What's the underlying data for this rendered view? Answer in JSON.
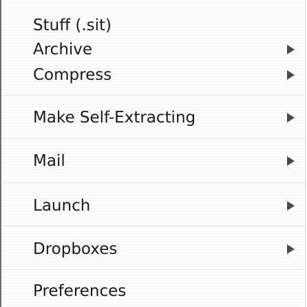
{
  "menu": {
    "items": [
      {
        "label": "Stuff (.sit)",
        "submenu": false
      },
      {
        "label": "Archive",
        "submenu": true
      },
      {
        "label": "Compress",
        "submenu": true
      },
      {
        "label": "Make Self-Extracting",
        "submenu": true
      },
      {
        "label": "Mail",
        "submenu": true
      },
      {
        "label": "Launch",
        "submenu": true
      },
      {
        "label": "Dropboxes",
        "submenu": true
      },
      {
        "label": "Preferences",
        "submenu": false
      }
    ]
  }
}
